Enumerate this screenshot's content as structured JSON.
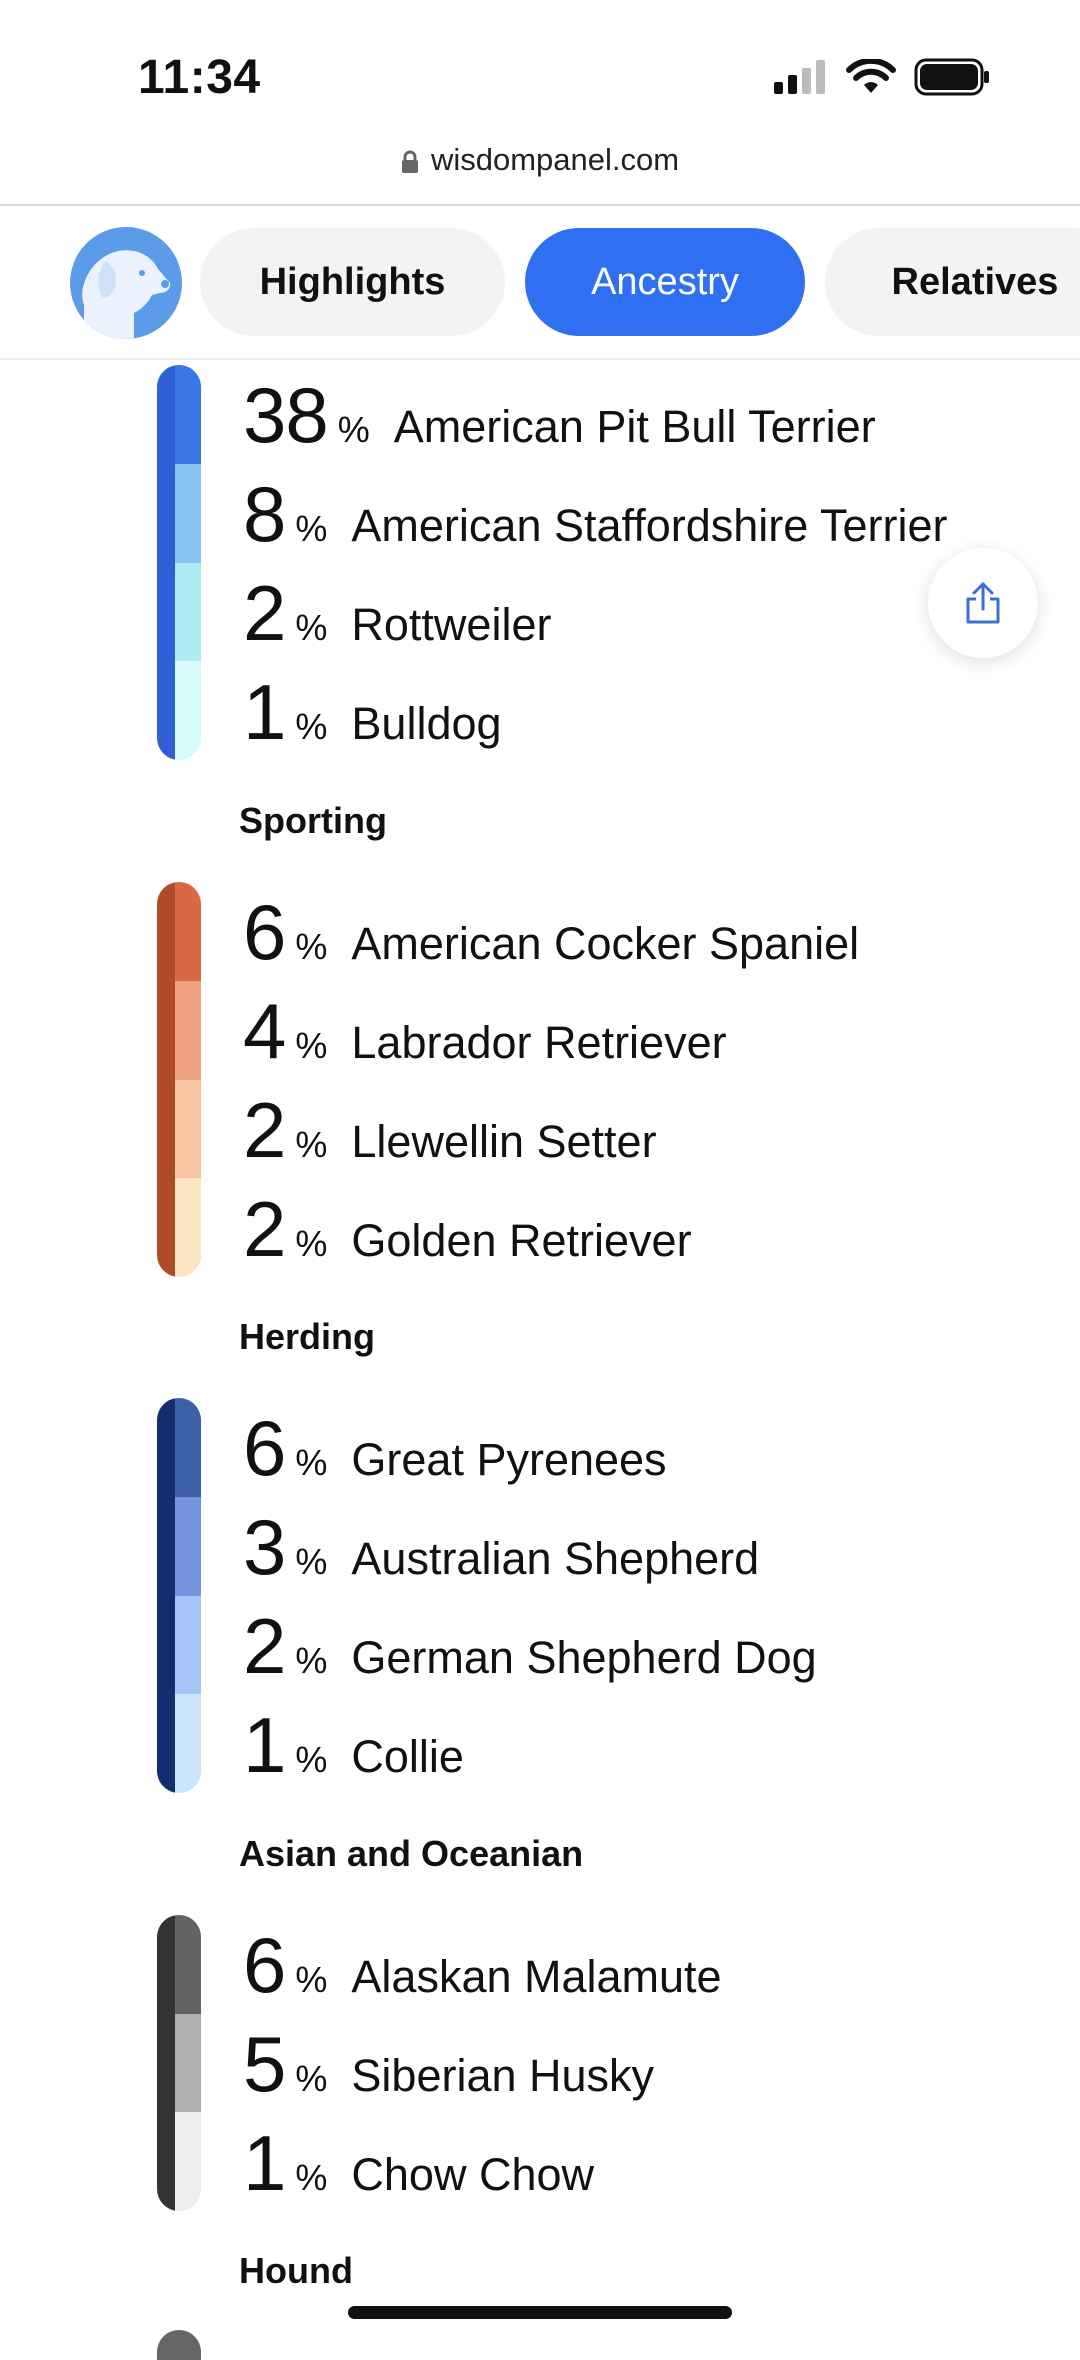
{
  "status_bar": {
    "time": "11:34",
    "icons": [
      "signal-icon",
      "wifi-icon",
      "battery-icon"
    ]
  },
  "browser": {
    "url": "wisdompanel.com",
    "icon": "lock-icon"
  },
  "tabs": {
    "avatar_icon": "dog-avatar-icon",
    "items": [
      {
        "label": "Highlights",
        "active": false
      },
      {
        "label": "Ancestry",
        "active": true
      },
      {
        "label": "Relatives",
        "active": false
      }
    ],
    "active_color": "#2f6ff2"
  },
  "share_button": {
    "icon": "share-icon"
  },
  "groups": [
    {
      "title": "",
      "colors_dark": [
        "#2f5fd6",
        "#2f5fd6",
        "#2f5fd6",
        "#2f5fd6"
      ],
      "colors_light": [
        "#3a78e8",
        "#86c3f2",
        "#b0ecf6",
        "#d7fbfb"
      ],
      "breeds": [
        {
          "pct": "38",
          "sign": "%",
          "name": "American Pit Bull Terrier"
        },
        {
          "pct": "8",
          "sign": "%",
          "name": "American Staffordshire Terrier"
        },
        {
          "pct": "2",
          "sign": "%",
          "name": "Rottweiler"
        },
        {
          "pct": "1",
          "sign": "%",
          "name": "Bulldog"
        }
      ]
    },
    {
      "title": "Sporting",
      "colors_dark": [
        "#b04b2a",
        "#b04b2a",
        "#b04b2a",
        "#b04b2a"
      ],
      "colors_light": [
        "#d76a45",
        "#eea27f",
        "#f6c4a3",
        "#fbe6c4"
      ],
      "breeds": [
        {
          "pct": "6",
          "sign": "%",
          "name": "American Cocker Spaniel"
        },
        {
          "pct": "4",
          "sign": "%",
          "name": "Labrador Retriever"
        },
        {
          "pct": "2",
          "sign": "%",
          "name": "Llewellin Setter"
        },
        {
          "pct": "2",
          "sign": "%",
          "name": "Golden Retriever"
        }
      ]
    },
    {
      "title": "Herding",
      "colors_dark": [
        "#142d6e",
        "#142d6e",
        "#142d6e",
        "#142d6e"
      ],
      "colors_light": [
        "#3d5fa8",
        "#7594dd",
        "#a9c4f8",
        "#c8e4fb"
      ],
      "breeds": [
        {
          "pct": "6",
          "sign": "%",
          "name": "Great Pyrenees"
        },
        {
          "pct": "3",
          "sign": "%",
          "name": "Australian Shepherd"
        },
        {
          "pct": "2",
          "sign": "%",
          "name": "German Shepherd Dog"
        },
        {
          "pct": "1",
          "sign": "%",
          "name": "Collie"
        }
      ]
    },
    {
      "title": "Asian and Oceanian",
      "colors_dark": [
        "#333333",
        "#333333",
        "#333333"
      ],
      "colors_light": [
        "#636363",
        "#b0b0b0",
        "#eeeeee"
      ],
      "breeds": [
        {
          "pct": "6",
          "sign": "%",
          "name": "Alaskan Malamute"
        },
        {
          "pct": "5",
          "sign": "%",
          "name": "Siberian Husky"
        },
        {
          "pct": "1",
          "sign": "%",
          "name": "Chow Chow"
        }
      ]
    },
    {
      "title": "Hound",
      "colors_dark": [],
      "colors_light": [],
      "breeds": []
    }
  ]
}
